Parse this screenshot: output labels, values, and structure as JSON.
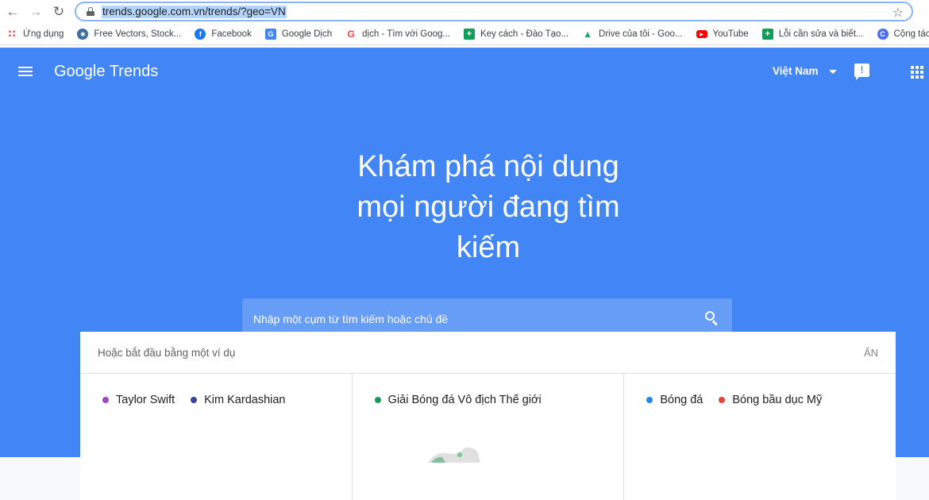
{
  "browser": {
    "url": "trends.google.com.vn/trends/?geo=VN",
    "bookmarks": [
      {
        "label": "Ứng dụng",
        "icon": "apps-grid-icon",
        "color": "#e8453c"
      },
      {
        "label": "Free Vectors, Stock...",
        "icon": "freepik-icon",
        "color": "#3b6ea5"
      },
      {
        "label": "Facebook",
        "icon": "facebook-icon",
        "color": "#1877f2"
      },
      {
        "label": "Google Dịch",
        "icon": "google-translate-icon",
        "color": "#4285f4"
      },
      {
        "label": "dịch - Tìm với Goog...",
        "icon": "google-icon",
        "color": "#ea4335"
      },
      {
        "label": "Key cách - Đào Tạo...",
        "icon": "sheets-icon",
        "color": "#0f9d58"
      },
      {
        "label": "Drive của tôi - Goo...",
        "icon": "drive-icon",
        "color": "#fbbc04"
      },
      {
        "label": "YouTube",
        "icon": "youtube-icon",
        "color": "#ff0000"
      },
      {
        "label": "Lỗi cần sửa và biết...",
        "icon": "sheets-icon",
        "color": "#0f9d58"
      },
      {
        "label": "Cộng tác & tạo th",
        "icon": "canva-icon",
        "color": "#4c6ef5"
      }
    ]
  },
  "header": {
    "logo_google": "Google",
    "logo_trends": "Trends",
    "country": "Việt Nam",
    "feedback_glyph": "!"
  },
  "hero": {
    "line1": "Khám phá nội dung",
    "line2": "mọi người đang tìm",
    "line3": "kiếm"
  },
  "search": {
    "placeholder": "Nhập một cụm từ tìm kiếm hoặc chủ đề"
  },
  "examples": {
    "heading": "Hoặc bắt đầu bằng một ví dụ",
    "hide_label": "ẨN",
    "cards": [
      {
        "terms": [
          {
            "label": "Taylor Swift",
            "color": "#a142c9"
          },
          {
            "label": "Kim Kardashian",
            "color": "#3742a8"
          }
        ]
      },
      {
        "terms": [
          {
            "label": "Giải Bóng đá Vô địch Thế giới",
            "color": "#0f9d58"
          }
        ]
      },
      {
        "terms": [
          {
            "label": "Bóng đá",
            "color": "#1e88e5"
          },
          {
            "label": "Bóng bầu dục Mỹ",
            "color": "#ea4335"
          }
        ]
      }
    ]
  },
  "colors": {
    "brand_blue": "#4285f4",
    "search_box": "#669df6"
  }
}
